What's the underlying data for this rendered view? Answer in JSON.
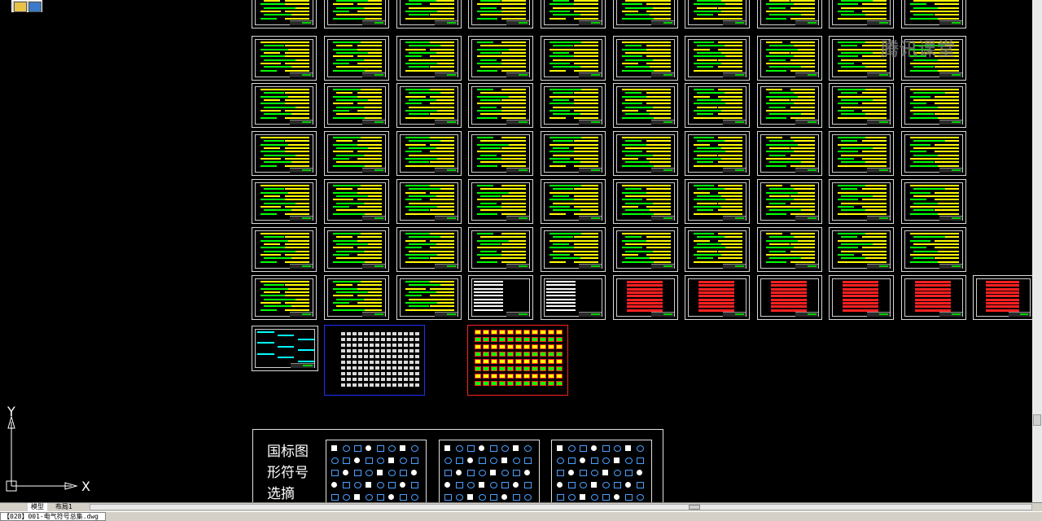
{
  "window": {
    "file_tab": "【028】001-电气符号总集.dwg"
  },
  "layout_tabs": [
    {
      "label": "模型",
      "active": true
    },
    {
      "label": "布局1",
      "active": false
    }
  ],
  "ucs": {
    "x_label": "X",
    "y_label": "Y"
  },
  "watermark": {
    "text": "腾讯课堂"
  },
  "legend": {
    "title_lines": [
      "国标图",
      "形符号",
      "选摘"
    ]
  },
  "colors": {
    "background": "#000000",
    "yellow": "#ffff00",
    "green": "#00ff00",
    "cyan": "#00ffff",
    "red": "#ff2020",
    "blue": "#2030ff"
  },
  "icons": {
    "toolbar": "layer-tool-icon",
    "scroll_arrow_left": "arrow-left-icon",
    "scroll_arrow_right": "arrow-right-icon"
  }
}
